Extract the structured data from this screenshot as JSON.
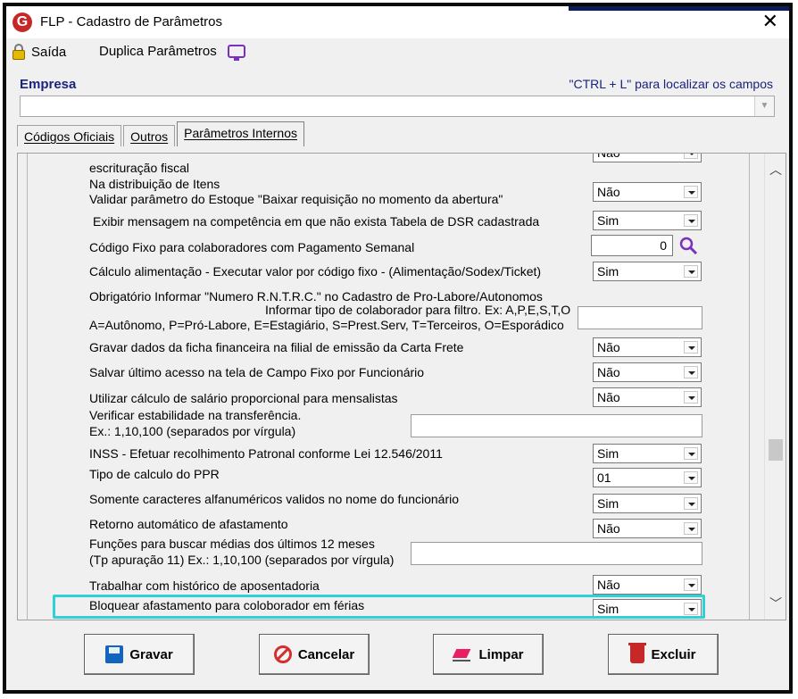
{
  "window": {
    "title": "FLP - Cadastro de Parâmetros",
    "logo_letter": "G",
    "close": "✕"
  },
  "menu": {
    "saida": "Saída",
    "duplica": "Duplica Parâmetros"
  },
  "empresa": {
    "label": "Empresa",
    "hint": "\"CTRL + L\" para localizar os campos",
    "value": ""
  },
  "tabs": [
    {
      "label": "Códigos Oficiais"
    },
    {
      "label": "Outros"
    },
    {
      "label": "Parâmetros Internos"
    }
  ],
  "params": {
    "r0": {
      "label": "escrituração fiscal",
      "value": "Não"
    },
    "r1": {
      "label1": "Na distribuição de Itens",
      "label2": "Validar parâmetro do Estoque \"Baixar requisição no momento da abertura\"",
      "value": "Não"
    },
    "r2": {
      "label": "Exibir mensagem na competência em que não exista Tabela de DSR cadastrada",
      "value": "Sim"
    },
    "r3": {
      "label": "Código Fixo para colaboradores com Pagamento Semanal",
      "value": "0"
    },
    "r4": {
      "label": "Cálculo alimentação - Executar valor por código fixo - (Alimentação/Sodex/Ticket)",
      "value": "Sim"
    },
    "r5": {
      "label": "Obrigatório Informar \"Numero R.N.T.R.C.\" no Cadastro de Pro-Labore/Autonomos"
    },
    "r6": {
      "label1": "Informar tipo de colaborador para filtro. Ex: A,P,E,S,T,O",
      "label2": "A=Autônomo, P=Pró-Labore, E=Estagiário, S=Prest.Serv, T=Terceiros, O=Esporádico",
      "value": ""
    },
    "r7": {
      "label": "Gravar dados da ficha financeira na filial de emissão da Carta Frete",
      "value": "Não"
    },
    "r8": {
      "label": "Salvar último acesso na tela de Campo Fixo por Funcionário",
      "value": "Não"
    },
    "r9": {
      "label": "Utilizar cálculo de salário proporcional para mensalistas",
      "value": "Não"
    },
    "r10": {
      "label1": "Verificar estabilidade na transferência.",
      "label2": "Ex.: 1,10,100 (separados por vírgula)",
      "value": ""
    },
    "r11": {
      "label": "INSS - Efetuar recolhimento Patronal conforme Lei 12.546/2011",
      "value": "Sim"
    },
    "r12": {
      "label": "Tipo de calculo do PPR",
      "value": "01"
    },
    "r13": {
      "label": "Somente caracteres alfanuméricos validos no nome do funcionário",
      "value": "Sim"
    },
    "r14": {
      "label": "Retorno automático de afastamento",
      "value": "Não"
    },
    "r15": {
      "label1": "Funções para buscar médias dos últimos 12 meses",
      "label2": "(Tp apuração 11)   Ex.: 1,10,100 (separados por vírgula)",
      "value": ""
    },
    "r16": {
      "label": "Trabalhar com histórico de aposentadoria",
      "value": "Não"
    },
    "r17": {
      "label": "Bloquear afastamento para coloborador em férias",
      "value": "Sim"
    }
  },
  "buttons": {
    "gravar": "Gravar",
    "cancelar": "Cancelar",
    "limpar": "Limpar",
    "excluir": "Excluir"
  },
  "colors": {
    "highlight": "#2fd0d8",
    "label_blue": "#1a237e",
    "brand_red": "#c62828"
  }
}
